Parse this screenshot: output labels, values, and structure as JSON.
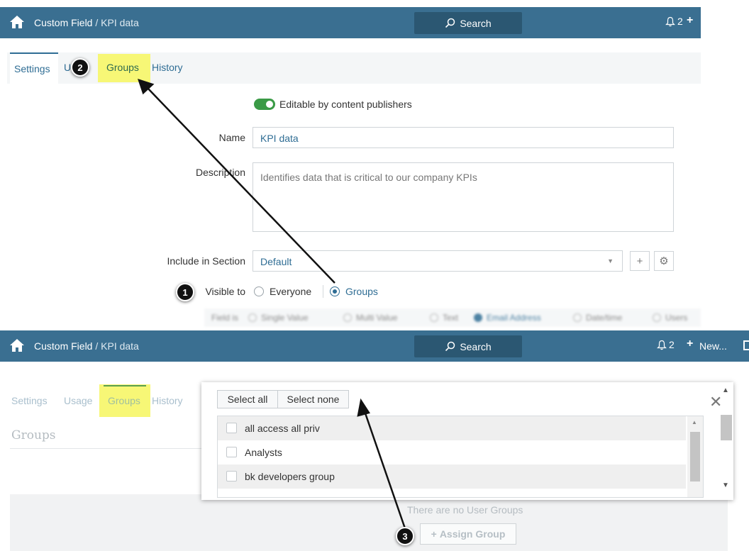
{
  "header_top": {
    "title": "Custom Field",
    "separator": " / ",
    "subtitle": "KPI data",
    "search_label": "Search",
    "notif_count": "2"
  },
  "tabs_top": [
    {
      "label": "Settings"
    },
    {
      "label": "U"
    },
    {
      "label": "Groups"
    },
    {
      "label": "History"
    }
  ],
  "form": {
    "toggle_label": "Editable by content publishers",
    "name_label": "Name",
    "name_value": "KPI data",
    "description_label": "Description",
    "description_value": "Identifies data that is critical to our company KPIs",
    "section_label": "Include in Section",
    "section_value": "Default",
    "visible_label": "Visible to",
    "visible_options": [
      "Everyone",
      "Groups"
    ],
    "visible_selected": "Groups",
    "field_is_label": "Field is",
    "field_types": [
      "Single Value",
      "Multi Value",
      "Text",
      "Email Address",
      "Date/time",
      "Users"
    ],
    "field_type_selected": "Email Address"
  },
  "header_bottom": {
    "title": "Custom Field",
    "separator": " / ",
    "subtitle": "KPI data",
    "search_label": "Search",
    "notif_count": "2",
    "new_label": "New..."
  },
  "tabs_bottom": [
    {
      "label": "Settings"
    },
    {
      "label": "Usage"
    },
    {
      "label": "Groups"
    },
    {
      "label": "History"
    }
  ],
  "groups_section": {
    "heading": "Groups",
    "empty_text": "There are no User Groups",
    "assign_label": "Assign Group"
  },
  "picker": {
    "select_all": "Select all",
    "select_none": "Select none",
    "items": [
      "all access all priv",
      "Analysts",
      "bk developers group"
    ]
  },
  "markers": [
    "1",
    "2",
    "3"
  ],
  "colors": {
    "header_bg": "#3a6f91",
    "search_bg": "#2b5772",
    "link": "#2f6d94",
    "highlight": "#f7f776",
    "toggle_on": "#3a9a46"
  }
}
